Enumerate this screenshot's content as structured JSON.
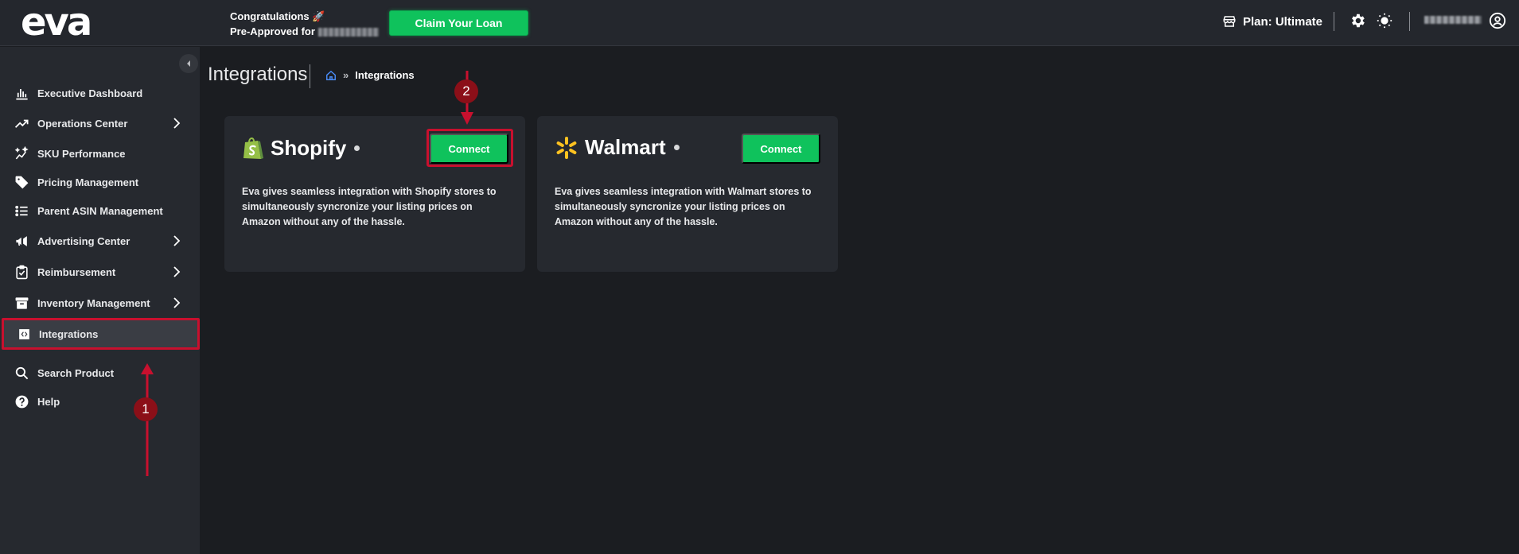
{
  "app": {
    "logo": "eva"
  },
  "header": {
    "promo_line1": "Congratulations 🚀",
    "promo_line2": "Pre-Approved for",
    "claim_button": "Claim Your Loan",
    "plan_label": "Plan: Ultimate"
  },
  "sidebar": {
    "items": [
      {
        "label": "Executive Dashboard",
        "icon": "bar-chart-icon",
        "has_submenu": false
      },
      {
        "label": "Operations Center",
        "icon": "trending-up-icon",
        "has_submenu": true
      },
      {
        "label": "SKU Performance",
        "icon": "sparkle-chart-icon",
        "has_submenu": false
      },
      {
        "label": "Pricing Management",
        "icon": "price-tag-icon",
        "has_submenu": false
      },
      {
        "label": "Parent ASIN Management",
        "icon": "list-icon",
        "has_submenu": false
      },
      {
        "label": "Advertising Center",
        "icon": "megaphone-icon",
        "has_submenu": true
      },
      {
        "label": "Reimbursement",
        "icon": "clipboard-check-icon",
        "has_submenu": true
      },
      {
        "label": "Inventory Management",
        "icon": "archive-box-icon",
        "has_submenu": true
      },
      {
        "label": "Integrations",
        "icon": "integration-icon",
        "has_submenu": false,
        "active": true
      },
      {
        "label": "Search Product",
        "icon": "search-icon",
        "has_submenu": false
      },
      {
        "label": "Help",
        "icon": "help-circle-icon",
        "has_submenu": false
      }
    ]
  },
  "main": {
    "title": "Integrations",
    "breadcrumb": {
      "separator": "»",
      "current": "Integrations"
    },
    "cards": [
      {
        "name": "Shopify",
        "connect_label": "Connect",
        "description": "Eva gives seamless integration with Shopify stores to simultaneously syncronize your listing prices on Amazon without any of the hassle."
      },
      {
        "name": "Walmart",
        "connect_label": "Connect",
        "description": "Eva gives seamless integration with Walmart stores to simultaneously syncronize your listing prices on Amazon without any of the hassle."
      }
    ]
  },
  "annotations": {
    "step1": "1",
    "step2": "2"
  },
  "colors": {
    "accent_green": "#0fc25c",
    "annotation_red": "#c8102e",
    "background": "#1b1d21",
    "panel": "#26292f"
  }
}
